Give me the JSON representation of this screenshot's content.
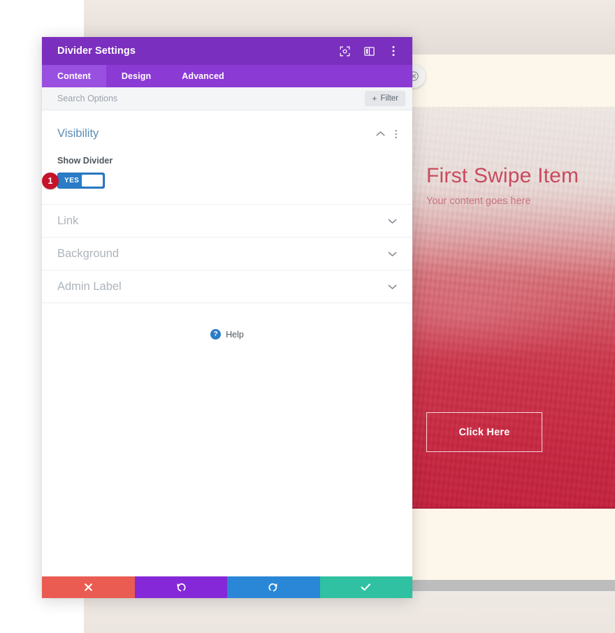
{
  "modal": {
    "title": "Divider Settings",
    "header_icons": [
      {
        "name": "focus-icon",
        "label": "Focus"
      },
      {
        "name": "layout-columns-icon",
        "label": "Layout"
      },
      {
        "name": "kebab-menu-icon",
        "label": "More options"
      }
    ],
    "tabs": [
      {
        "label": "Content",
        "active": true
      },
      {
        "label": "Design",
        "active": false
      },
      {
        "label": "Advanced",
        "active": false
      }
    ],
    "search": {
      "placeholder": "Search Options",
      "value": "",
      "filter_label": "Filter",
      "filter_plus": "+"
    },
    "sections": {
      "visibility": {
        "title": "Visibility",
        "expanded": true,
        "field_label": "Show Divider",
        "toggle_value": "YES",
        "step_badge": "1"
      },
      "collapsed": [
        {
          "title": "Link"
        },
        {
          "title": "Background"
        },
        {
          "title": "Admin Label"
        }
      ]
    },
    "help": {
      "icon_glyph": "?",
      "label": "Help"
    },
    "footer_buttons": [
      {
        "name": "cancel-button",
        "icon": "close-x-icon",
        "color": "#ea5c52"
      },
      {
        "name": "undo-button",
        "icon": "undo-arrow-icon",
        "color": "#8428d8"
      },
      {
        "name": "redo-button",
        "icon": "redo-arrow-icon",
        "color": "#2a86d6"
      },
      {
        "name": "save-button",
        "icon": "checkmark-icon",
        "color": "#2fc1a1"
      }
    ]
  },
  "page": {
    "hero": {
      "title": "First Swipe Item",
      "subtitle": "Your content goes here",
      "button_label": "Click Here"
    },
    "close_button": {
      "name": "close-circle-icon"
    }
  },
  "colors": {
    "header_purple": "#7b2fbe",
    "tabs_purple": "#8b3ad4",
    "tab_active_purple": "#9950e0",
    "section_title_blue": "#5b8cb5",
    "toggle_blue": "#2a7cc7",
    "badge_red": "#c5142a",
    "hero_title_red": "#c94a5e",
    "cancel_red": "#ea5c52",
    "undo_purple": "#8428d8",
    "redo_blue": "#2a86d6",
    "save_teal": "#2fc1a1",
    "cream": "#fdf6ea",
    "gray_bar": "#bdbdbd"
  }
}
